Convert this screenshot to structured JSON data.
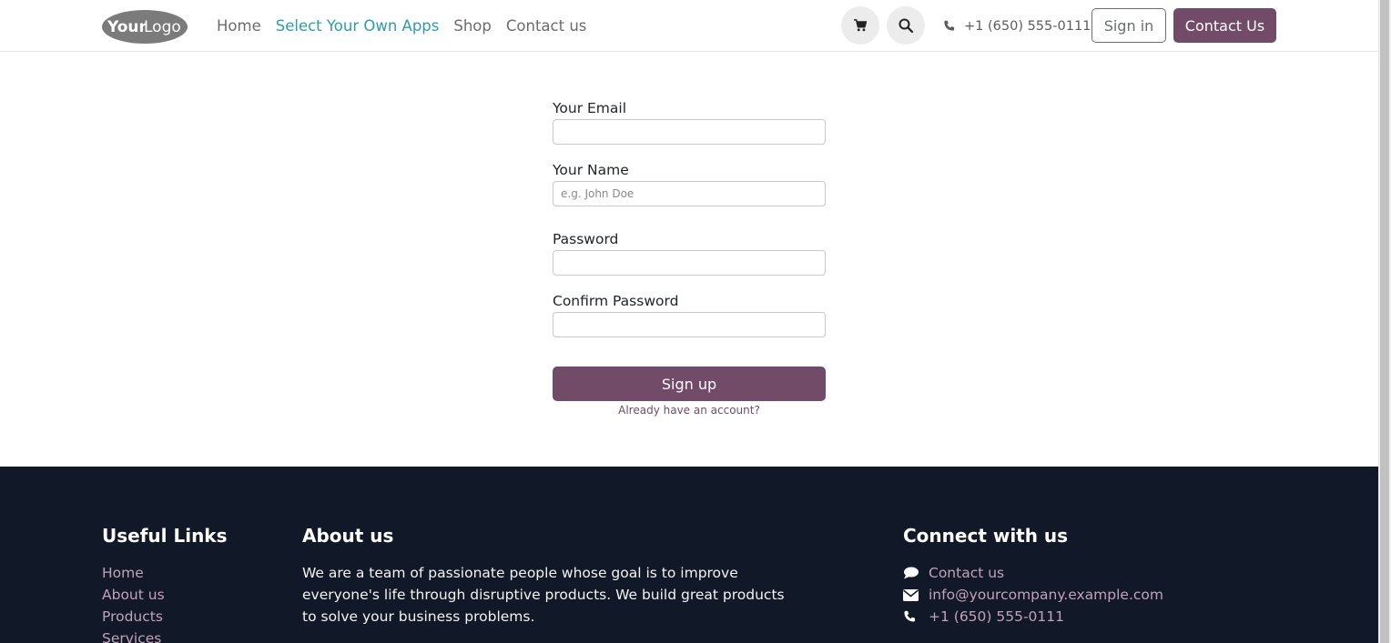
{
  "header": {
    "logo_text_1": "Your",
    "logo_text_2": "Logo",
    "nav": [
      {
        "label": "Home",
        "active": false
      },
      {
        "label": "Select Your Own Apps",
        "active": true
      },
      {
        "label": "Shop",
        "active": false
      },
      {
        "label": "Contact us",
        "active": false
      }
    ],
    "cart_icon": "cart-icon",
    "search_icon": "search-icon",
    "phone_icon": "phone-icon",
    "phone": "+1 (650) 555-0111",
    "signin_label": "Sign in",
    "contact_label": "Contact Us"
  },
  "form": {
    "email_label": "Your Email",
    "email_value": "",
    "name_label": "Your Name",
    "name_placeholder": "e.g. John Doe",
    "password_label": "Password",
    "confirm_label": "Confirm Password",
    "signup_label": "Sign up",
    "already_label": "Already have an account?"
  },
  "footer": {
    "useful_title": "Useful Links",
    "useful_links": [
      "Home",
      "About us",
      "Products",
      "Services"
    ],
    "about_title": "About us",
    "about_text": "We are a team of passionate people whose goal is to improve everyone's life through disruptive products. We build great products to solve your business problems.",
    "connect_title": "Connect with us",
    "connect_items": [
      {
        "icon": "comment-icon",
        "label": "Contact us"
      },
      {
        "icon": "envelope-icon",
        "label": "info@yourcompany.example.com"
      },
      {
        "icon": "phone-icon",
        "label": "+1 (650) 555-0111"
      }
    ]
  },
  "colors": {
    "brand": "#714b67",
    "nav_active": "#2a9db0",
    "footer_bg": "#111827",
    "footer_link": "#c1a3b9"
  }
}
